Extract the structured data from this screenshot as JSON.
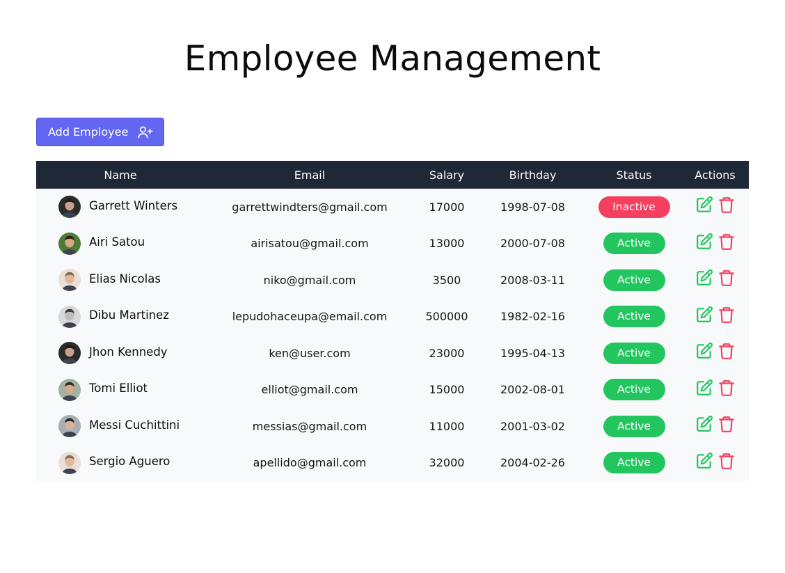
{
  "page": {
    "title": "Employee Management"
  },
  "toolbar": {
    "add_label": "Add Employee",
    "add_icon": "user-plus-icon"
  },
  "table": {
    "columns": [
      "Name",
      "Email",
      "Salary",
      "Birthday",
      "Status",
      "Actions"
    ],
    "rows": [
      {
        "name": "Garrett Winters",
        "email": "garrettwindters@gmail.com",
        "salary": "17000",
        "birthday": "1998-07-08",
        "status": "Inactive"
      },
      {
        "name": "Airi Satou",
        "email": "airisatou@gmail.com",
        "salary": "13000",
        "birthday": "2000-07-08",
        "status": "Active"
      },
      {
        "name": "Elias Nicolas",
        "email": "niko@gmail.com",
        "salary": "3500",
        "birthday": "2008-03-11",
        "status": "Active"
      },
      {
        "name": "Dibu Martinez",
        "email": "lepudohaceupa@email.com",
        "salary": "500000",
        "birthday": "1982-02-16",
        "status": "Active"
      },
      {
        "name": "Jhon Kennedy",
        "email": "ken@user.com",
        "salary": "23000",
        "birthday": "1995-04-13",
        "status": "Active"
      },
      {
        "name": "Tomi Elliot",
        "email": "elliot@gmail.com",
        "salary": "15000",
        "birthday": "2002-08-01",
        "status": "Active"
      },
      {
        "name": "Messi Cuchittini",
        "email": "messias@gmail.com",
        "salary": "11000",
        "birthday": "2001-03-02",
        "status": "Active"
      },
      {
        "name": "Sergio Aguero",
        "email": "apellido@gmail.com",
        "salary": "32000",
        "birthday": "2004-02-26",
        "status": "Active"
      }
    ]
  },
  "icons": {
    "edit": "edit-icon",
    "delete": "trash-icon",
    "avatar": "avatar"
  },
  "colors": {
    "primary": "#6366f1",
    "header_bg": "#1e2836",
    "active": "#22c55e",
    "inactive": "#f43f5e",
    "edit_icon": "#22c55e",
    "delete_icon": "#f43f5e"
  }
}
